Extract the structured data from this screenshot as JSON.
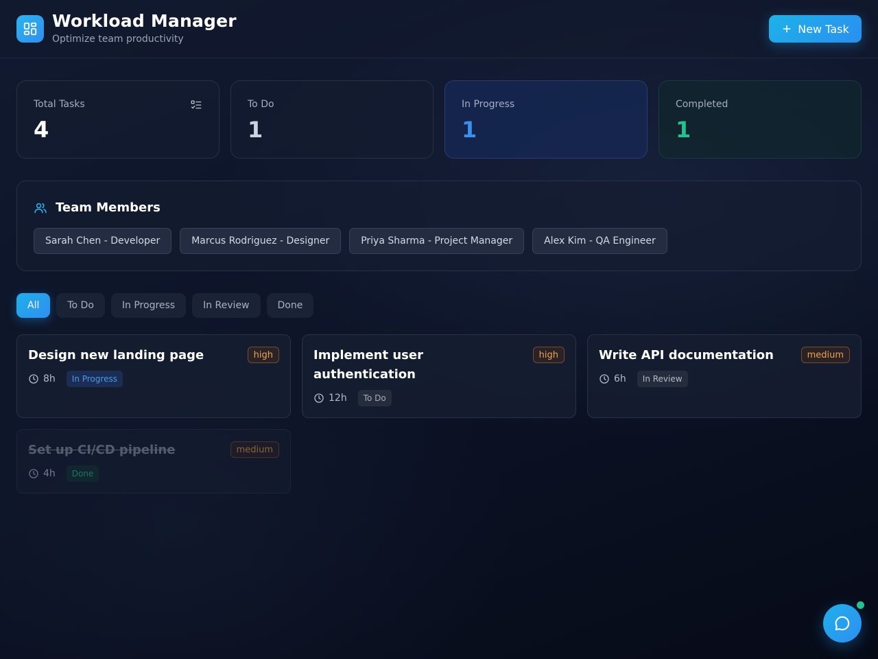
{
  "header": {
    "title": "Workload Manager",
    "subtitle": "Optimize team productivity",
    "new_task_label": "New Task"
  },
  "stats": [
    {
      "label": "Total Tasks",
      "value": "4"
    },
    {
      "label": "To Do",
      "value": "1"
    },
    {
      "label": "In Progress",
      "value": "1"
    },
    {
      "label": "Completed",
      "value": "1"
    }
  ],
  "team": {
    "title": "Team Members",
    "members": [
      "Sarah Chen - Developer",
      "Marcus Rodriguez - Designer",
      "Priya Sharma - Project Manager",
      "Alex Kim - QA Engineer"
    ]
  },
  "filters": [
    "All",
    "To Do",
    "In Progress",
    "In Review",
    "Done"
  ],
  "tasks": [
    {
      "title": "Design new landing page",
      "priority": "high",
      "hours": "8h",
      "status": "In Progress"
    },
    {
      "title": "Implement user authentication",
      "priority": "high",
      "hours": "12h",
      "status": "To Do"
    },
    {
      "title": "Write API documentation",
      "priority": "medium",
      "hours": "6h",
      "status": "In Review"
    },
    {
      "title": "Set up CI/CD pipeline",
      "priority": "medium",
      "hours": "4h",
      "status": "Done"
    }
  ],
  "colors": {
    "accent": "#2e8ff0",
    "in_progress": "#3b8ff0",
    "completed": "#27c090",
    "priority": "#f0a24a"
  },
  "icons": {
    "logo": "dashboard-grid-icon",
    "new_task": "plus-icon",
    "total_tasks": "checklist-icon",
    "team": "users-icon",
    "hours": "clock-icon",
    "chat": "chat-bubble-icon"
  }
}
